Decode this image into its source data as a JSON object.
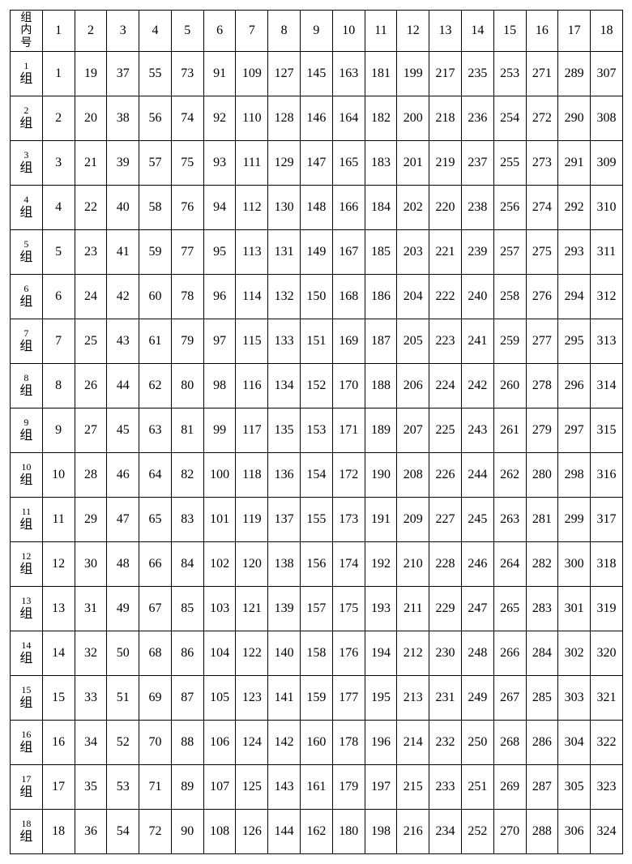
{
  "chart_data": {
    "type": "table",
    "title": "",
    "corner_lines": [
      "组",
      "内",
      "号"
    ],
    "zu_char": "组",
    "columns": [
      1,
      2,
      3,
      4,
      5,
      6,
      7,
      8,
      9,
      10,
      11,
      12,
      13,
      14,
      15,
      16,
      17,
      18
    ],
    "rows": [
      1,
      2,
      3,
      4,
      5,
      6,
      7,
      8,
      9,
      10,
      11,
      12,
      13,
      14,
      15,
      16,
      17,
      18
    ],
    "data": [
      [
        1,
        19,
        37,
        55,
        73,
        91,
        109,
        127,
        145,
        163,
        181,
        199,
        217,
        235,
        253,
        271,
        289,
        307
      ],
      [
        2,
        20,
        38,
        56,
        74,
        92,
        110,
        128,
        146,
        164,
        182,
        200,
        218,
        236,
        254,
        272,
        290,
        308
      ],
      [
        3,
        21,
        39,
        57,
        75,
        93,
        111,
        129,
        147,
        165,
        183,
        201,
        219,
        237,
        255,
        273,
        291,
        309
      ],
      [
        4,
        22,
        40,
        58,
        76,
        94,
        112,
        130,
        148,
        166,
        184,
        202,
        220,
        238,
        256,
        274,
        292,
        310
      ],
      [
        5,
        23,
        41,
        59,
        77,
        95,
        113,
        131,
        149,
        167,
        185,
        203,
        221,
        239,
        257,
        275,
        293,
        311
      ],
      [
        6,
        24,
        42,
        60,
        78,
        96,
        114,
        132,
        150,
        168,
        186,
        204,
        222,
        240,
        258,
        276,
        294,
        312
      ],
      [
        7,
        25,
        43,
        61,
        79,
        97,
        115,
        133,
        151,
        169,
        187,
        205,
        223,
        241,
        259,
        277,
        295,
        313
      ],
      [
        8,
        26,
        44,
        62,
        80,
        98,
        116,
        134,
        152,
        170,
        188,
        206,
        224,
        242,
        260,
        278,
        296,
        314
      ],
      [
        9,
        27,
        45,
        63,
        81,
        99,
        117,
        135,
        153,
        171,
        189,
        207,
        225,
        243,
        261,
        279,
        297,
        315
      ],
      [
        10,
        28,
        46,
        64,
        82,
        100,
        118,
        136,
        154,
        172,
        190,
        208,
        226,
        244,
        262,
        280,
        298,
        316
      ],
      [
        11,
        29,
        47,
        65,
        83,
        101,
        119,
        137,
        155,
        173,
        191,
        209,
        227,
        245,
        263,
        281,
        299,
        317
      ],
      [
        12,
        30,
        48,
        66,
        84,
        102,
        120,
        138,
        156,
        174,
        192,
        210,
        228,
        246,
        264,
        282,
        300,
        318
      ],
      [
        13,
        31,
        49,
        67,
        85,
        103,
        121,
        139,
        157,
        175,
        193,
        211,
        229,
        247,
        265,
        283,
        301,
        319
      ],
      [
        14,
        32,
        50,
        68,
        86,
        104,
        122,
        140,
        158,
        176,
        194,
        212,
        230,
        248,
        266,
        284,
        302,
        320
      ],
      [
        15,
        33,
        51,
        69,
        87,
        105,
        123,
        141,
        159,
        177,
        195,
        213,
        231,
        249,
        267,
        285,
        303,
        321
      ],
      [
        16,
        34,
        52,
        70,
        88,
        106,
        124,
        142,
        160,
        178,
        196,
        214,
        232,
        250,
        268,
        286,
        304,
        322
      ],
      [
        17,
        35,
        53,
        71,
        89,
        107,
        125,
        143,
        161,
        179,
        197,
        215,
        233,
        251,
        269,
        287,
        305,
        323
      ],
      [
        18,
        36,
        54,
        72,
        90,
        108,
        126,
        144,
        162,
        180,
        198,
        216,
        234,
        252,
        270,
        288,
        306,
        324
      ]
    ]
  }
}
